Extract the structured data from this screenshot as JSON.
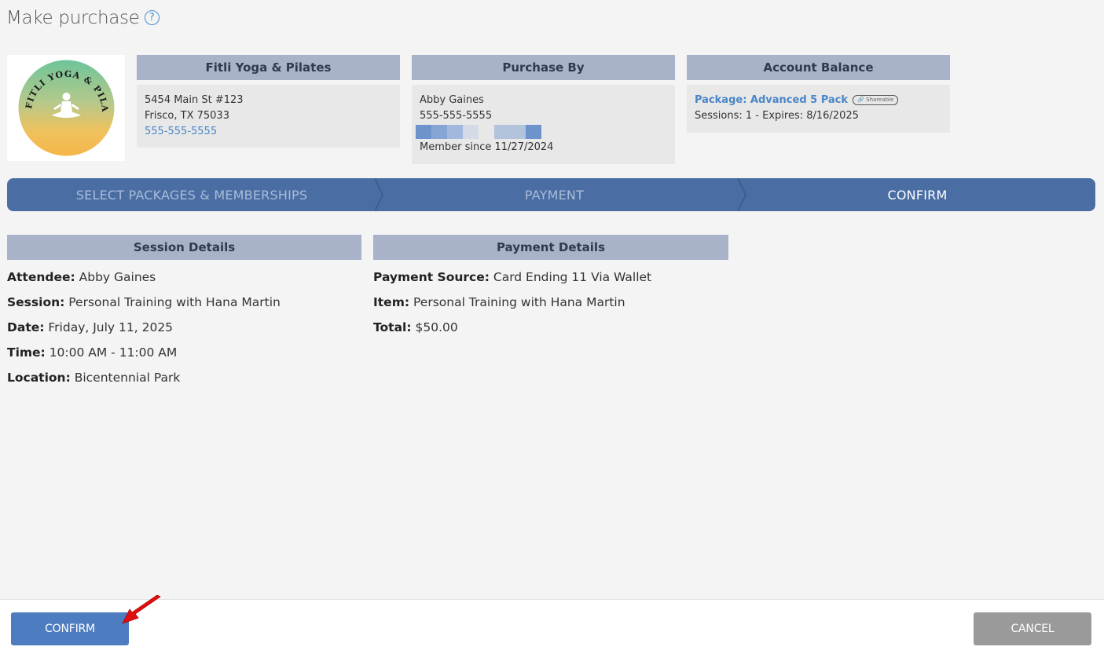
{
  "header": {
    "title": "Make purchase",
    "help_icon": "question-circle-icon"
  },
  "studio": {
    "logo_text": "FITLI YOGA & PILATES",
    "name": "Fitli Yoga & Pilates",
    "address_line1": "5454 Main St #123",
    "address_line2": "Frisco, TX 75033",
    "phone": "555-555-5555"
  },
  "purchaser": {
    "heading": "Purchase By",
    "name": "Abby Gaines",
    "phone": "555-555-5555",
    "member_since": "Member since 11/27/2024"
  },
  "account": {
    "heading": "Account Balance",
    "package_name": "Package: Advanced 5 Pack",
    "badge": "Shareable",
    "sessions_line": "Sessions: 1 -  Expires: 8/16/2025"
  },
  "steps": [
    {
      "label": "SELECT PACKAGES & MEMBERSHIPS",
      "state": "done"
    },
    {
      "label": "PAYMENT",
      "state": "done"
    },
    {
      "label": "CONFIRM",
      "state": "active"
    }
  ],
  "session_details": {
    "heading": "Session Details",
    "rows": [
      {
        "label": "Attendee:",
        "value": "Abby Gaines"
      },
      {
        "label": "Session:",
        "value": "Personal Training with Hana Martin"
      },
      {
        "label": "Date:",
        "value": "Friday, July 11, 2025"
      },
      {
        "label": "Time:",
        "value": "10:00 AM - 11:00 AM"
      },
      {
        "label": "Location:",
        "value": "Bicentennial Park"
      }
    ]
  },
  "payment_details": {
    "heading": "Payment Details",
    "rows": [
      {
        "label": "Payment Source:",
        "value": "Card Ending 11 Via Wallet"
      },
      {
        "label": "Item:",
        "value": "Personal Training with Hana Martin"
      },
      {
        "label": "Total:",
        "value": "$50.00"
      }
    ]
  },
  "footer": {
    "confirm_label": "CONFIRM",
    "cancel_label": "CANCEL"
  },
  "colors": {
    "accent": "#4a6ea4",
    "header_bar": "#a8b2c8",
    "confirm_button": "#4e7cc0",
    "cancel_button": "#9a9a9a",
    "annotation_arrow": "#e01010"
  }
}
